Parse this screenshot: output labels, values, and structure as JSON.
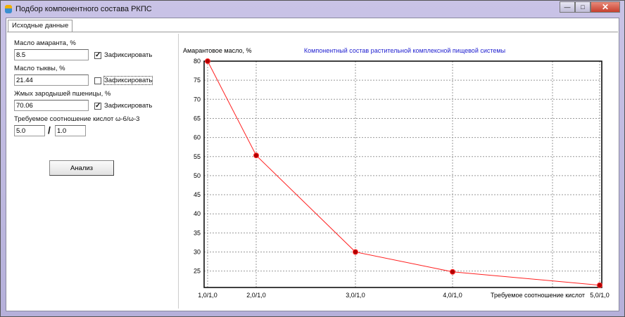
{
  "window": {
    "title": "Подбор компонентного состава РКПС",
    "minimize": "—",
    "maximize": "□",
    "close": "✕"
  },
  "tabs": [
    {
      "label": "Исходные данные"
    }
  ],
  "form": {
    "amaranth_label": "Масло амаранта, %",
    "amaranth_value": "8.5",
    "amaranth_fixed": true,
    "pumpkin_label": "Масло тыквы, %",
    "pumpkin_value": "21.44",
    "pumpkin_fixed": false,
    "germ_label": "Жмых зародышей пшеницы, %",
    "germ_value": "70.06",
    "germ_fixed": true,
    "fix_label": "Зафиксировать",
    "ratio_label": "Требуемое соотношение кислот ω-6/ω-3",
    "ratio_n6": "5.0",
    "ratio_sep": "/",
    "ratio_n3": "1.0",
    "analyze_button": "Анализ"
  },
  "chart_data": {
    "type": "line",
    "title": "Компонентный состав растительной комплексной пищевой системы",
    "ylabel": "Амарантовое масло, %",
    "xlabel": "Требуемое соотношение кислот",
    "categories": [
      "1,0/1,0",
      "2,0/1,0",
      "3,0/1,0",
      "4,0/1,0",
      "5,0/1,0"
    ],
    "values": [
      80,
      55.3,
      30,
      24.8,
      21.3
    ],
    "yticks": [
      25,
      30,
      35,
      40,
      45,
      50,
      55,
      60,
      65,
      70,
      75,
      80
    ],
    "ylim": [
      20.7,
      80
    ],
    "grid": true,
    "colors": {
      "line": "#ff2020",
      "marker": "#b00000",
      "title": "#2020d0"
    }
  }
}
